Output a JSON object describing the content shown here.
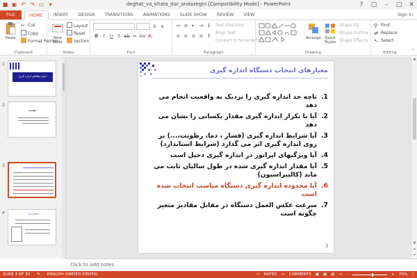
{
  "window": {
    "title": "deghat_va_khata_dar_andazegiri [Compatibility Mode] - PowerPoint",
    "sign_in": "Sign in"
  },
  "tabs": [
    {
      "label": "FILE"
    },
    {
      "label": "HOME"
    },
    {
      "label": "INSERT"
    },
    {
      "label": "DESIGN"
    },
    {
      "label": "TRANSITIONS"
    },
    {
      "label": "ANIMATIONS"
    },
    {
      "label": "SLIDE SHOW"
    },
    {
      "label": "REVIEW"
    },
    {
      "label": "VIEW"
    }
  ],
  "ribbon": {
    "clipboard": {
      "label": "Clipboard",
      "paste": "Paste",
      "cut": "Cut",
      "copy": "Copy",
      "format_painter": "Format Painter"
    },
    "slides": {
      "label": "Slides",
      "new_slide": "New Slide",
      "layout": "Layout",
      "reset": "Reset",
      "section": "Section"
    },
    "font": {
      "label": "Font"
    },
    "paragraph": {
      "label": "Paragraph",
      "text_direction": "Text Direction",
      "align_text": "Align Text",
      "convert_smartart": "Convert to SmartArt"
    },
    "drawing": {
      "label": "Drawing",
      "arrange": "Arrange",
      "quick_styles": "Quick Styles",
      "shape_fill": "Shape Fill",
      "shape_outline": "Shape Outline",
      "shape_effects": "Shape Effects"
    },
    "editing": {
      "label": "Editing",
      "find": "Find",
      "replace": "Replace",
      "select": "Select"
    }
  },
  "thumbnails": [
    {
      "num": "1",
      "title": "انواع خطاهای اندازه گیری"
    },
    {
      "num": "2",
      "title": "مقدمه"
    },
    {
      "num": "3"
    },
    {
      "num": "4",
      "title": "Accuracy"
    }
  ],
  "slide": {
    "title": "معیارهای انتخاب دستگاه اندازه گیری",
    "page_number": "3",
    "bullets": [
      {
        "num": ".1",
        "text": "تاچه حد اندازه گیری را نزدیک به واقعیت انجام می دهد"
      },
      {
        "num": ".2",
        "text": "آیا با تکرار اندازه گیری مقدار یکسانی را نشان می دهد"
      },
      {
        "num": ".3",
        "text": "آیا شرایط اندازه گیری (فشار ، دما، رطوبت،...) بر روی اندازه گیری اثر می گذارد (شرایط استاندارد)"
      },
      {
        "num": ".4",
        "text": "آیا ویژگیهای اپراتور در اندازه گیری دخیل است"
      },
      {
        "num": ".5",
        "text": "آیا مقدار اندازه گیری شده در طول سالیان ثابت می ماند (کالیبراسیون)"
      },
      {
        "num": ".6",
        "text": "آیا محدوده اندازه گیری دستگاه مناسب انتخاب شده است"
      },
      {
        "num": ".7",
        "text": "سرعت عکس العمل دستگاه در مقابل مقادیر متغیر چگونه است"
      }
    ]
  },
  "notes": {
    "placeholder": "Click to add notes"
  },
  "statusbar": {
    "slide_info": "SLIDE 3 OF 30",
    "language": "ENGLISH (UNITED STATES)",
    "notes": "NOTES",
    "comments": "COMMENTS",
    "zoom": "70%"
  },
  "colors": {
    "accent": "#d24726",
    "title": "#6a6ed0",
    "highlight": "#c8412a"
  }
}
